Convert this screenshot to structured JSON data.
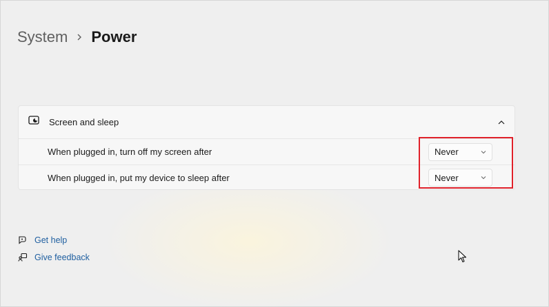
{
  "breadcrumb": {
    "parent": "System",
    "separator": "›",
    "current": "Power"
  },
  "screen_sleep": {
    "icon": "monitor-sleep-icon",
    "title": "Screen and sleep",
    "expanded": true,
    "rows": [
      {
        "label": "When plugged in, turn off my screen after",
        "value": "Never"
      },
      {
        "label": "When plugged in, put my device to sleep after",
        "value": "Never"
      }
    ]
  },
  "highlight_color": "#e0212a",
  "links": {
    "get_help": "Get help",
    "give_feedback": "Give feedback"
  }
}
